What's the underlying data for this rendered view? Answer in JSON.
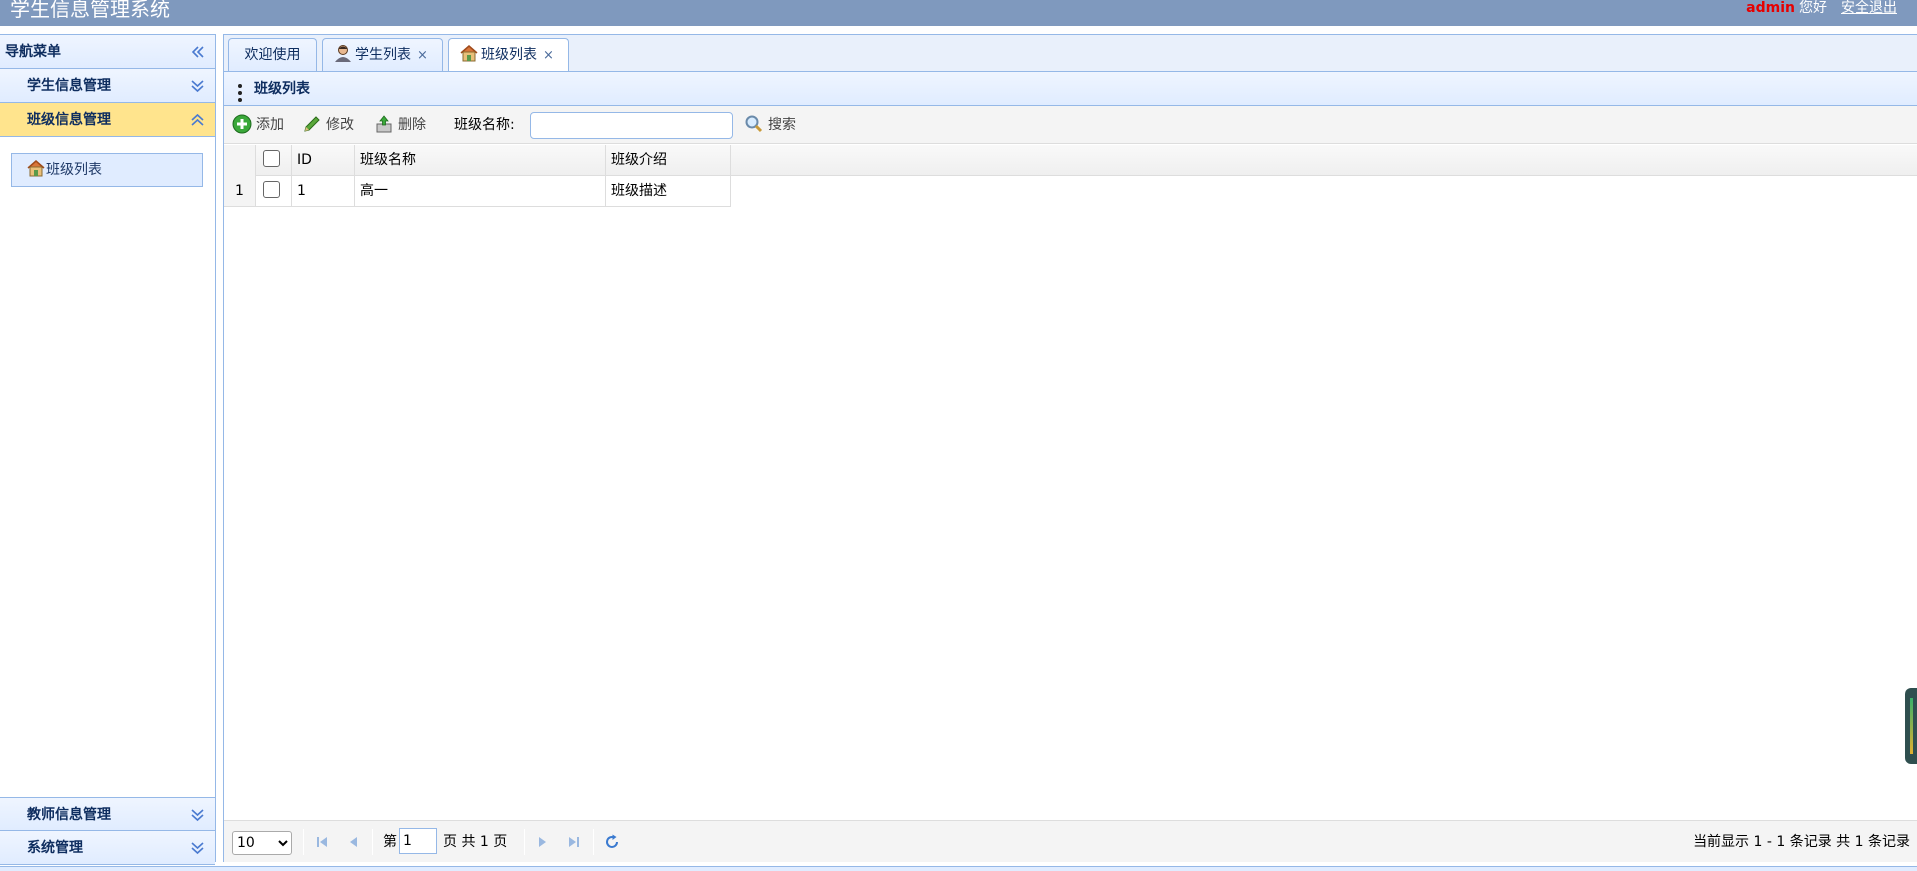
{
  "header": {
    "app_title": "学生信息管理系统",
    "user": "admin",
    "greeting": "您好",
    "logout": "安全退出"
  },
  "sidebar": {
    "title": "导航菜单",
    "sections": [
      {
        "label": "学生信息管理",
        "expanded": false
      },
      {
        "label": "班级信息管理",
        "expanded": true,
        "items": [
          {
            "label": "班级列表",
            "icon": "house-icon"
          }
        ]
      },
      {
        "label": "教师信息管理",
        "expanded": false
      },
      {
        "label": "系统管理",
        "expanded": false
      }
    ]
  },
  "tabs": [
    {
      "label": "欢迎使用",
      "closable": false,
      "active": false
    },
    {
      "label": "学生列表",
      "icon": "student-icon",
      "closable": true,
      "active": false
    },
    {
      "label": "班级列表",
      "icon": "house-icon",
      "closable": true,
      "active": true
    }
  ],
  "tab_close_glyph": "×",
  "main": {
    "title": "班级列表",
    "toolbar": {
      "add_label": "添加",
      "edit_label": "修改",
      "delete_label": "删除",
      "search_label": "班级名称:",
      "search_value": "",
      "search_button": "搜索"
    },
    "grid": {
      "columns": [
        "ID",
        "班级名称",
        "班级介绍"
      ],
      "rows": [
        {
          "rownum": "1",
          "id": "1",
          "name": "高一",
          "intro": "班级描述"
        }
      ]
    },
    "pager": {
      "page_size": "10",
      "page_size_options": [
        "10"
      ],
      "page_prefix": "第",
      "page_value": "1",
      "page_suffix": "页 共 1 页",
      "info": "当前显示 1 - 1 条记录 共 1 条记录"
    }
  },
  "colors": {
    "header_bg": "#7f99be",
    "panel_border": "#95b8e7",
    "selected_section": "#ffe48d",
    "admin_red": "#e60000"
  }
}
